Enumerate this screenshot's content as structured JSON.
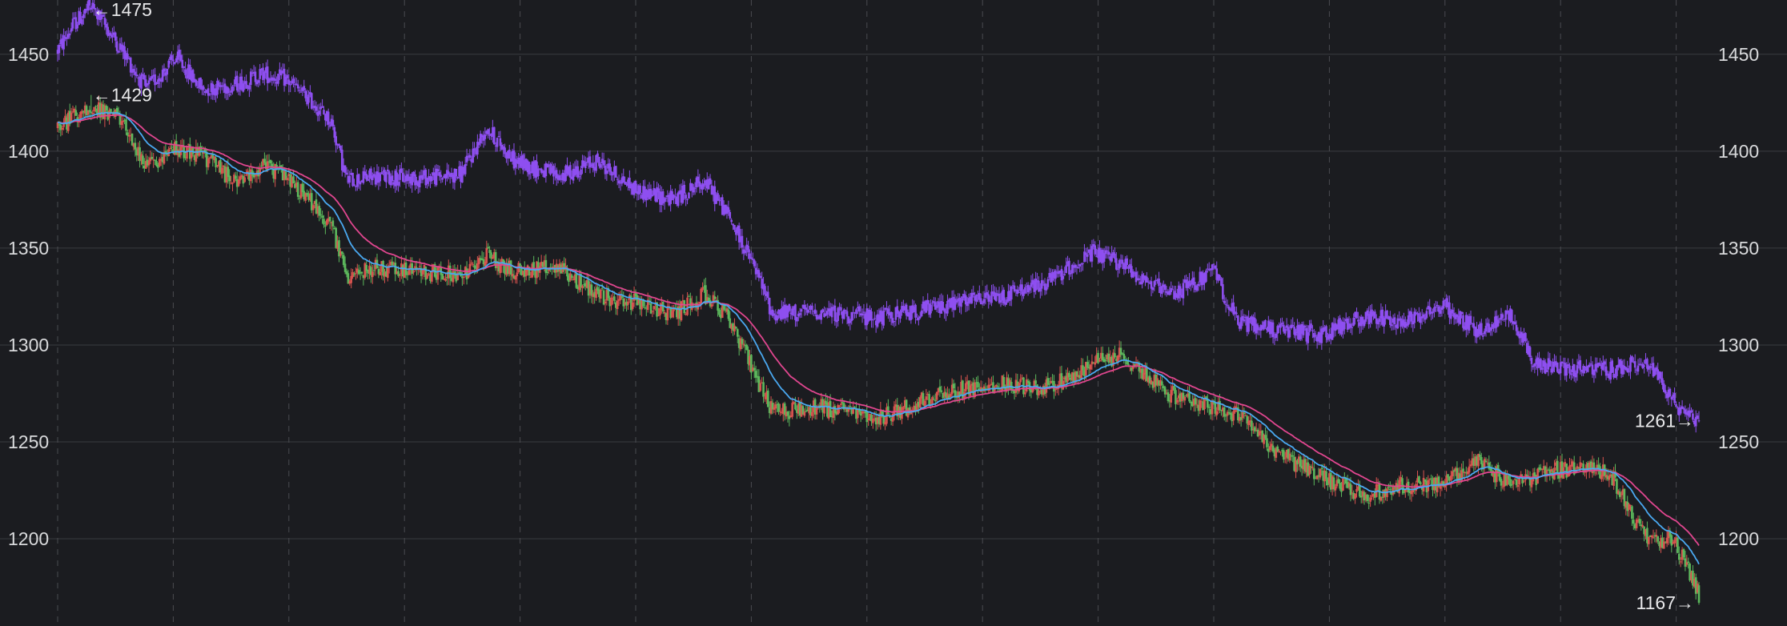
{
  "chart_data": {
    "type": "candlestick",
    "title": "",
    "xlabel": "",
    "ylabel": "",
    "ylim": [
      1155,
      1478
    ],
    "yticks": [
      1200,
      1250,
      1300,
      1350,
      1400,
      1450
    ],
    "grid": true,
    "colors": {
      "background": "#1b1c20",
      "up": "#d9534f",
      "down": "#5cb85c",
      "upper_series": "#8e4ff0",
      "ma_fast": "#4aa8f0",
      "ma_slow": "#e0468f",
      "grid": "#3a3b40",
      "text": "#d9dadc"
    },
    "series": [
      {
        "role": "upper",
        "anchors": [
          [
            0,
            1452
          ],
          [
            10,
            1465
          ],
          [
            22,
            1475
          ],
          [
            40,
            1455
          ],
          [
            58,
            1432
          ],
          [
            78,
            1448
          ],
          [
            95,
            1432
          ],
          [
            115,
            1434
          ],
          [
            135,
            1440
          ],
          [
            150,
            1437
          ],
          [
            168,
            1425
          ],
          [
            180,
            1415
          ],
          [
            190,
            1385
          ],
          [
            210,
            1387
          ],
          [
            235,
            1386
          ],
          [
            265,
            1388
          ],
          [
            282,
            1412
          ],
          [
            300,
            1395
          ],
          [
            330,
            1387
          ],
          [
            355,
            1395
          ],
          [
            380,
            1380
          ],
          [
            405,
            1375
          ],
          [
            425,
            1385
          ],
          [
            440,
            1368
          ],
          [
            458,
            1340
          ],
          [
            470,
            1316
          ],
          [
            500,
            1317
          ],
          [
            540,
            1314
          ],
          [
            580,
            1320
          ],
          [
            620,
            1325
          ],
          [
            650,
            1332
          ],
          [
            680,
            1347
          ],
          [
            700,
            1342
          ],
          [
            730,
            1325
          ],
          [
            760,
            1338
          ],
          [
            775,
            1312
          ],
          [
            800,
            1308
          ],
          [
            830,
            1305
          ],
          [
            860,
            1315
          ],
          [
            880,
            1312
          ],
          [
            910,
            1320
          ],
          [
            935,
            1307
          ],
          [
            955,
            1316
          ],
          [
            972,
            1290
          ],
          [
            990,
            1288
          ],
          [
            1020,
            1287
          ],
          [
            1040,
            1290
          ],
          [
            1052,
            1286
          ],
          [
            1062,
            1270
          ],
          [
            1079,
            1262
          ]
        ]
      },
      {
        "role": "lower",
        "anchors": [
          [
            0,
            1412
          ],
          [
            10,
            1418
          ],
          [
            22,
            1422
          ],
          [
            40,
            1418
          ],
          [
            52,
            1400
          ],
          [
            60,
            1392
          ],
          [
            78,
            1402
          ],
          [
            95,
            1398
          ],
          [
            115,
            1385
          ],
          [
            135,
            1392
          ],
          [
            150,
            1388
          ],
          [
            168,
            1372
          ],
          [
            180,
            1362
          ],
          [
            190,
            1335
          ],
          [
            210,
            1340
          ],
          [
            235,
            1338
          ],
          [
            265,
            1336
          ],
          [
            282,
            1346
          ],
          [
            300,
            1338
          ],
          [
            330,
            1340
          ],
          [
            355,
            1325
          ],
          [
            380,
            1322
          ],
          [
            405,
            1316
          ],
          [
            425,
            1326
          ],
          [
            440,
            1315
          ],
          [
            458,
            1285
          ],
          [
            470,
            1265
          ],
          [
            500,
            1268
          ],
          [
            540,
            1262
          ],
          [
            580,
            1275
          ],
          [
            620,
            1280
          ],
          [
            650,
            1278
          ],
          [
            680,
            1290
          ],
          [
            700,
            1295
          ],
          [
            730,
            1275
          ],
          [
            760,
            1268
          ],
          [
            775,
            1264
          ],
          [
            800,
            1245
          ],
          [
            830,
            1232
          ],
          [
            860,
            1222
          ],
          [
            880,
            1228
          ],
          [
            910,
            1228
          ],
          [
            935,
            1240
          ],
          [
            955,
            1227
          ],
          [
            972,
            1232
          ],
          [
            990,
            1236
          ],
          [
            1020,
            1235
          ],
          [
            1040,
            1205
          ],
          [
            1052,
            1198
          ],
          [
            1062,
            1200
          ],
          [
            1079,
            1172
          ]
        ]
      }
    ],
    "candle_count": 1080,
    "annotations": [
      {
        "label": "←1475",
        "series": "upper",
        "index": 22,
        "value": 1475,
        "kind": "max"
      },
      {
        "label": "←1429",
        "series": "lower",
        "index": 22,
        "value": 1429,
        "kind": "max"
      },
      {
        "label": "1261→",
        "series": "upper",
        "index": 1079,
        "value": 1261,
        "kind": "last"
      },
      {
        "label": "1167→",
        "series": "lower",
        "index": 1079,
        "value": 1167,
        "kind": "last"
      }
    ]
  }
}
